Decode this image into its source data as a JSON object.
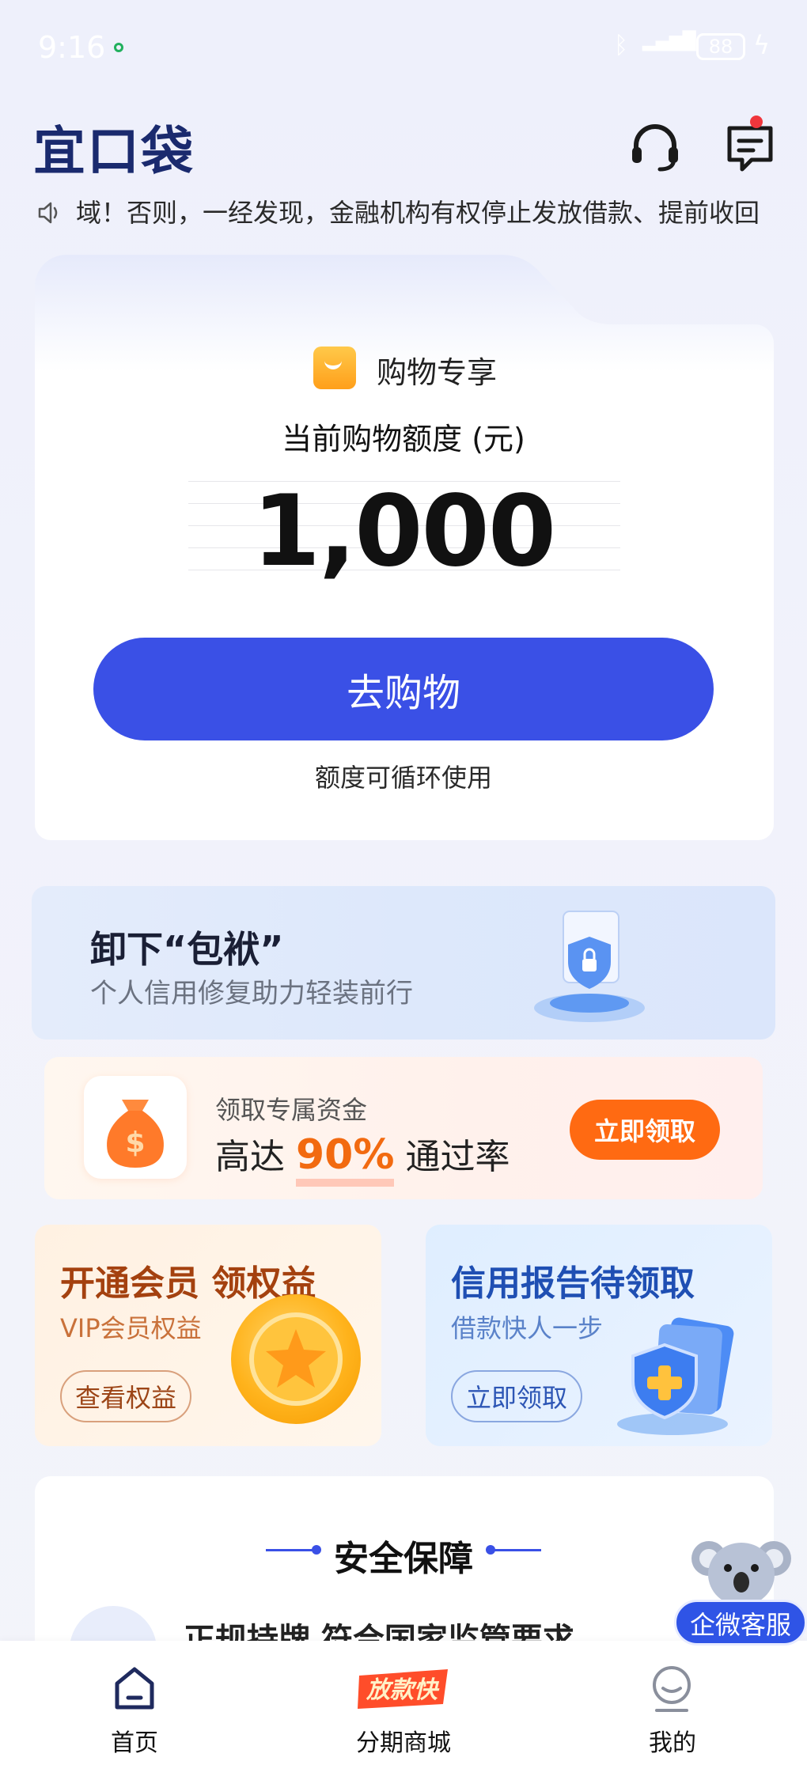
{
  "status_bar": {
    "time": "9:16",
    "battery": "88"
  },
  "header": {
    "logo": "宜口袋",
    "icons": [
      "headset-icon",
      "message-icon"
    ]
  },
  "ticker": {
    "text": "域！否则，一经发现，金融机构有权停止发放借款、提前收回"
  },
  "main_card": {
    "tag": "购物专享",
    "quota_label": "当前购物额度 (元)",
    "quota_amount": "1,000",
    "button": "去购物",
    "note": "额度可循环使用"
  },
  "credit_banner": {
    "title": "卸下“包袱”",
    "subtitle": "个人信用修复助力轻装前行"
  },
  "fund_banner": {
    "label": "领取专属资金",
    "rate_prefix": "高达",
    "rate_value": "90%",
    "rate_suffix": "通过率",
    "button": "立即领取"
  },
  "vip_card": {
    "title": "开通会员 领权益",
    "subtitle": "VIP会员权益",
    "button": "查看权益"
  },
  "report_card": {
    "title": "信用报告待领取",
    "subtitle": "借款快人一步",
    "button": "立即领取"
  },
  "security": {
    "title": "安全保障",
    "item": "正规持牌 符合国家监管要求"
  },
  "service_float": {
    "label": "企微客服"
  },
  "bottom_nav": {
    "home": "首页",
    "mall_badge": "放款快",
    "mall": "分期商城",
    "me": "我的"
  },
  "colors": {
    "primary": "#3a50e6",
    "orange": "#ff6a12",
    "vip": "#a4410f",
    "report": "#1f4fb3"
  }
}
